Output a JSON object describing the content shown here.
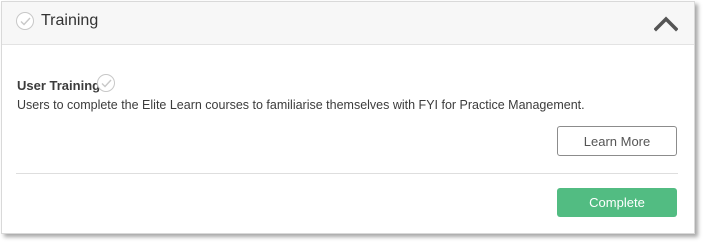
{
  "section": {
    "title": "Training",
    "collapse_icon": "chevron-up-icon"
  },
  "item": {
    "title": "User Training",
    "status_icon": "check-circle-icon",
    "description": "Users to complete the Elite Learn courses to familiarise themselves with FYI for Practice Management."
  },
  "actions": {
    "learn_more_label": "Learn More",
    "complete_label": "Complete"
  },
  "colors": {
    "complete_button": "#52bc82",
    "header_background": "#f7f7f7",
    "check_icon": "#c8c8c8"
  }
}
